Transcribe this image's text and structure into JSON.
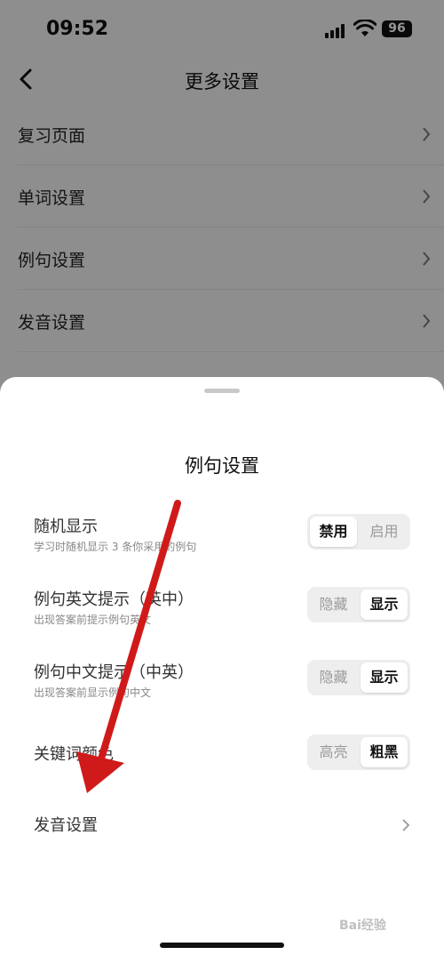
{
  "status_bar": {
    "time": "09:52",
    "battery": "96"
  },
  "nav": {
    "title": "更多设置"
  },
  "background_list": [
    {
      "label": "复习页面"
    },
    {
      "label": "单词设置"
    },
    {
      "label": "例句设置"
    },
    {
      "label": "发音设置"
    }
  ],
  "sheet": {
    "title": "例句设置",
    "options": [
      {
        "name": "随机显示",
        "desc": "学习时随机显示 3 条你采用的例句",
        "left": "禁用",
        "right": "启用",
        "active": "left"
      },
      {
        "name": "例句英文提示（英中）",
        "desc": "出现答案前提示例句英文",
        "left": "隐藏",
        "right": "显示",
        "active": "right"
      },
      {
        "name": "例句中文提示（中英）",
        "desc": "出现答案前显示例句中文",
        "left": "隐藏",
        "right": "显示",
        "active": "right"
      },
      {
        "name": "关键词颜色",
        "desc": "",
        "left": "高亮",
        "right": "粗黑",
        "active": "right"
      }
    ],
    "link": {
      "label": "发音设置"
    }
  },
  "watermark": "Bai经验",
  "colors": {
    "arrow": "#d01a1a",
    "overlay": "rgba(0,0,0,0.42)"
  }
}
